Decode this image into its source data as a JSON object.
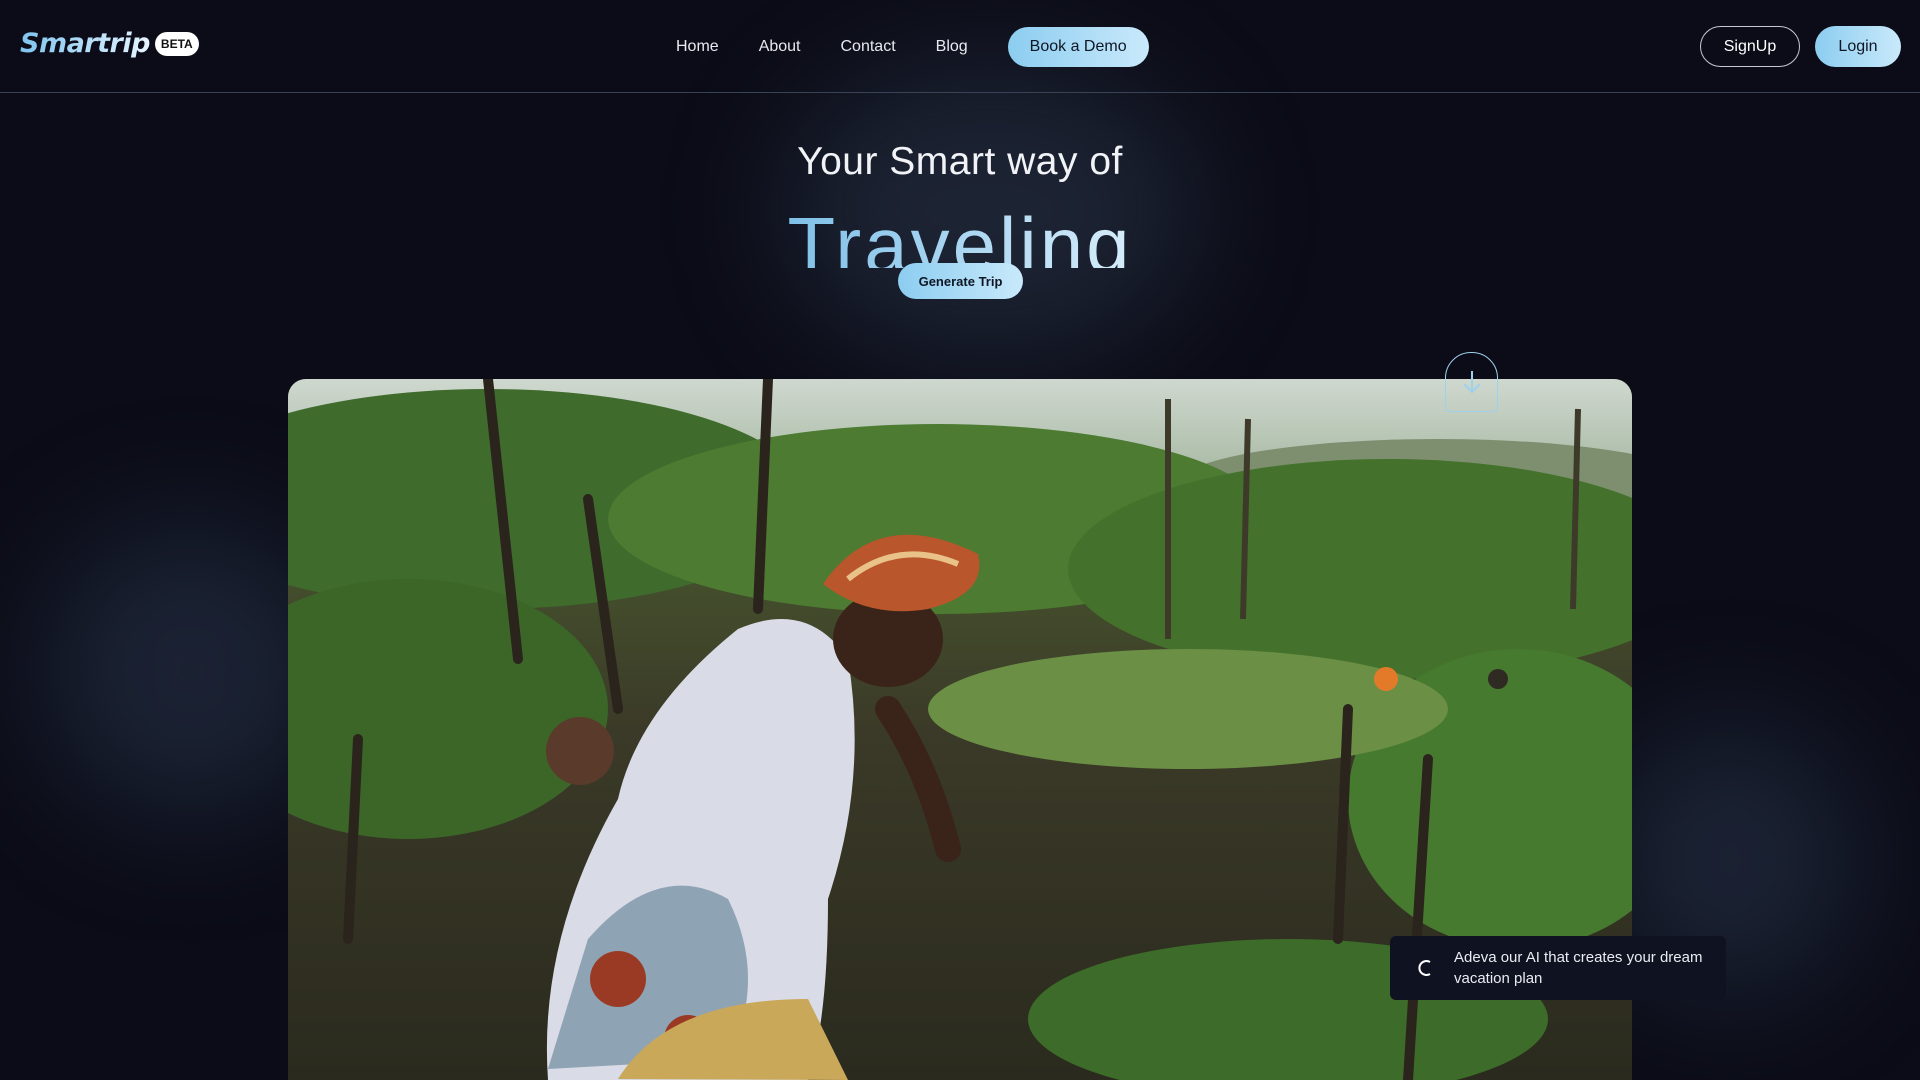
{
  "brand": {
    "name": "Smartrip",
    "badge": "BETA"
  },
  "nav": {
    "links": [
      "Home",
      "About",
      "Contact",
      "Blog"
    ],
    "cta": "Book a Demo"
  },
  "auth": {
    "signup": "SignUp",
    "login": "Login"
  },
  "hero": {
    "line1": "Your Smart way of",
    "line2": "Traveling",
    "generate_button": "Generate Trip"
  },
  "toast": {
    "text": "Adeva our AI that creates your dream vacation plan"
  },
  "colors": {
    "background": "#0b0c17",
    "accent": "#8ccdf0",
    "divider": "#3a4356"
  }
}
